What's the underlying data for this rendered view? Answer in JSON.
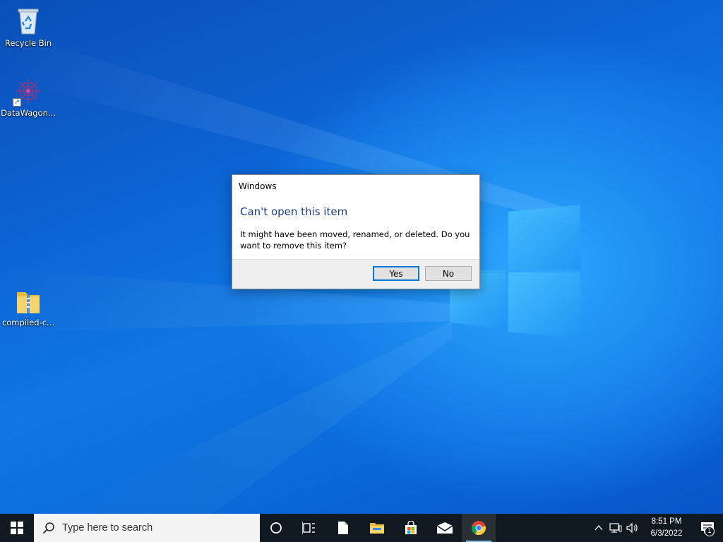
{
  "desktop": {
    "icons": [
      {
        "label": "Recycle Bin"
      },
      {
        "label": "DataWagon..."
      },
      {
        "label": "compiled-c..."
      }
    ]
  },
  "dialog": {
    "title": "Windows",
    "heading": "Can't open this item",
    "message": "It might have been moved, renamed, or deleted. Do you want to remove this item?",
    "yes_label": "Yes",
    "no_label": "No"
  },
  "taskbar": {
    "search_placeholder": "Type here to search",
    "pinned": [
      "cortana-icon",
      "task-view-icon",
      "file-icon",
      "file-explorer-icon",
      "store-icon",
      "mail-icon",
      "chrome-icon"
    ],
    "clock_time": "8:51 PM",
    "clock_date": "6/3/2022",
    "notification_count": "1"
  },
  "colors": {
    "accent": "#0078d7",
    "taskbar_bg": "#101820",
    "heading": "#1c3d8a"
  }
}
